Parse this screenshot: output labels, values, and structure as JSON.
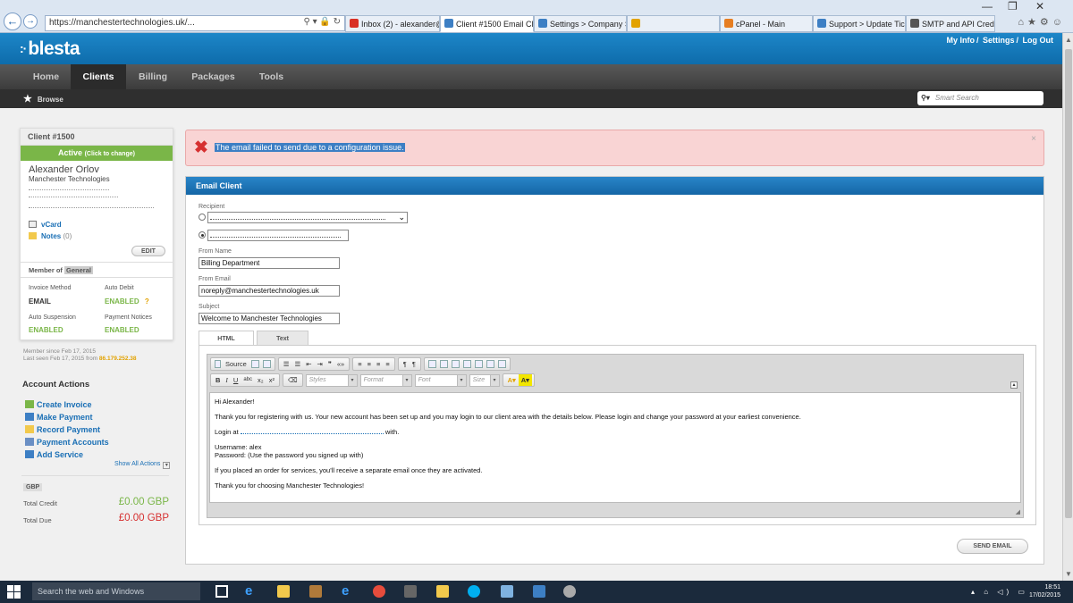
{
  "browser": {
    "address": "https://manchestertechnologies.uk/...",
    "tabs": [
      {
        "label": "Inbox (2) - alexander@m...",
        "color": "#d93025",
        "active": false
      },
      {
        "label": "Client #1500 Email Cli...",
        "color": "#3d7fc4",
        "active": true
      },
      {
        "label": "Settings > Company > E...",
        "color": "#3d7fc4",
        "active": false
      },
      {
        "label": "",
        "color": "#e2a200",
        "active": false
      },
      {
        "label": "cPanel - Main",
        "color": "#e67e22",
        "active": false
      },
      {
        "label": "Support > Update Ticket...",
        "color": "#3d7fc4",
        "active": false
      },
      {
        "label": "SMTP and API Credentia...",
        "color": "#555555",
        "active": false
      }
    ]
  },
  "app": {
    "logo": "blesta",
    "top_links": [
      "My Info",
      "Settings",
      "Log Out"
    ],
    "nav": [
      "Home",
      "Clients",
      "Billing",
      "Packages",
      "Tools"
    ],
    "active_nav": "Clients",
    "subnav": "Browse",
    "search_placeholder": "Smart Search"
  },
  "client": {
    "title": "Client #1500",
    "status": "Active",
    "status_hint": "(Click to change)",
    "name": "Alexander Orlov",
    "company": "Manchester Technologies",
    "vcard": "vCard",
    "notes": "Notes",
    "notes_count": "(0)",
    "edit": "EDIT",
    "member_of": "Member of",
    "group": "General",
    "invoice_method_label": "Invoice Method",
    "invoice_method": "EMAIL",
    "auto_debit_label": "Auto Debit",
    "auto_debit": "ENABLED",
    "auto_debit_q": "?",
    "auto_suspension_label": "Auto Suspension",
    "auto_suspension": "ENABLED",
    "payment_notices_label": "Payment Notices",
    "payment_notices": "ENABLED",
    "member_since": "Member since Feb 17, 2015",
    "last_seen": "Last seen Feb 17, 2015 from",
    "ip": "86.179.252.38"
  },
  "actions": {
    "title": "Account Actions",
    "items": [
      "Create Invoice",
      "Make Payment",
      "Record Payment",
      "Payment Accounts",
      "Add Service"
    ],
    "show_all": "Show All Actions"
  },
  "finance": {
    "currency": "GBP",
    "total_credit_label": "Total Credit",
    "total_credit": "£0.00 GBP",
    "total_due_label": "Total Due",
    "total_due": "£0.00 GBP",
    "credit_color": "#7ab648",
    "due_color": "#d63030"
  },
  "alert": {
    "message": "The email failed to send due to a configuration issue.",
    "close": "×"
  },
  "email": {
    "panel_title": "Email Client",
    "recipient_label": "Recipient",
    "from_name_label": "From Name",
    "from_name": "Billing Department",
    "from_email_label": "From Email",
    "from_email": "noreply@manchestertechnologies.uk",
    "subject_label": "Subject",
    "subject": "Welcome to Manchester Technologies",
    "tabs": [
      "HTML",
      "Text"
    ],
    "toolbar": {
      "source": "Source",
      "bold": "B",
      "italic": "I",
      "underline": "U",
      "strike": "abc",
      "sub": "x₂",
      "sup": "x²",
      "styles": "Styles",
      "format": "Format",
      "font": "Font",
      "size": "Size"
    },
    "body": {
      "greeting": "Hi Alexander!",
      "intro": "Thank you for registering with us. Your new account has been set up and you may login to our client area with the details below. Please login and change your password at your earliest convenience.",
      "login_prefix": "Login at",
      "login_suffix": "with.",
      "username": "Username: alex",
      "password": "Password: (Use the password you signed up with)",
      "services": "If you placed an order for services, you'll receive a separate email once they are activated.",
      "closing": "Thank you for choosing Manchester Technologies!"
    },
    "send": "SEND EMAIL"
  },
  "taskbar": {
    "search": "Search the web and Windows",
    "time": "18:51",
    "date": "17/02/2015"
  }
}
